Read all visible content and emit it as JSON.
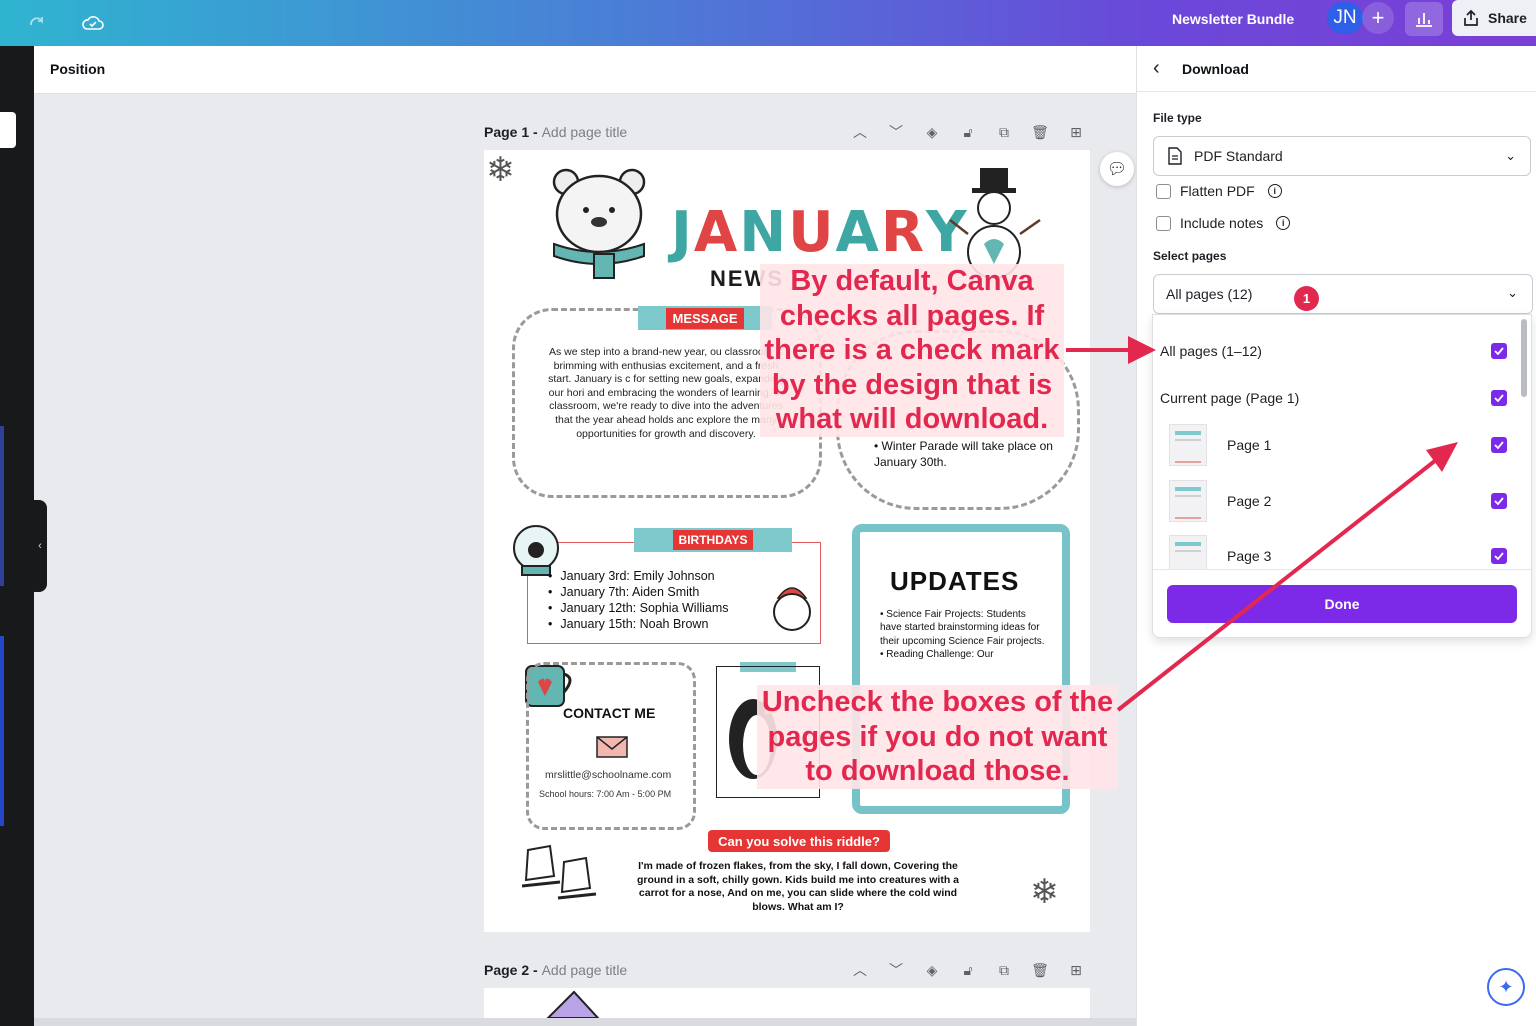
{
  "topbar": {
    "title": "Newsletter Bundle",
    "avatar_initials": "JN",
    "add_symbol": "+",
    "share_label": "Share"
  },
  "toolbar": {
    "position_label": "Position"
  },
  "pages": [
    {
      "label": "Page 1 - ",
      "title_placeholder": "Add page title"
    },
    {
      "label": "Page 2 - ",
      "title_placeholder": "Add page title"
    }
  ],
  "newsletter": {
    "title_letters": [
      "J",
      "A",
      "N",
      "U",
      "A",
      "R",
      "Y"
    ],
    "subtitle": "NEWS",
    "message_banner": "MESSAGE",
    "message_text": "As we step into a brand-new year, ou classroom is brimming with enthusias excitement, and a fresh start. January is c for setting new goals, expanding our hori and embracing the wonders of learning. In classroom, we're ready to dive into the adventures that the year ahead holds anc explore the many opportunities for growth and discovery.",
    "winter_parade": "Winter Parade will take place on January 30th.",
    "birthdays_banner": "BIRTHDAYS",
    "birthdays": [
      "January 3rd: Emily Johnson",
      "January 7th: Aiden Smith",
      "January 12th: Sophia Williams",
      "January 15th: Noah Brown"
    ],
    "updates_title": "UPDATES",
    "updates_items": [
      "Science Fair Projects: Students have started brainstorming ideas for their upcoming Science Fair projects.",
      "Reading Challenge: Our"
    ],
    "contact_title": "CONTACT ME",
    "contact_email": "mrslittle@schoolname.com",
    "contact_hours": "School hours: 7:00 Am - 5:00 PM",
    "riddle_banner": "Can you solve this riddle?",
    "riddle_text": "I'm made of frozen flakes, from the sky, I fall down, Covering the ground in a soft, chilly gown. Kids build me into creatures with a carrot for a nose, And on me, you can slide where the cold wind blows. What am I?"
  },
  "annotations": {
    "note1": "By default, Canva checks all pages. If there is a check mark by the design that is what will download.",
    "note2": "Uncheck the boxes of the pages if you do not want to download those.",
    "colors": {
      "accent": "#e3284f",
      "highlight": "#ffe4e8"
    }
  },
  "download_panel": {
    "title": "Download",
    "file_type_label": "File type",
    "file_type_value": "PDF Standard",
    "flatten_pdf": {
      "label": "Flatten PDF",
      "checked": false
    },
    "include_notes": {
      "label": "Include notes",
      "checked": false
    },
    "select_pages_label": "Select pages",
    "select_pages_value": "All pages (12)",
    "step_badge": "1",
    "options": [
      {
        "label": "All pages (1–12)",
        "checked": true,
        "thumb": false
      },
      {
        "label": "Current page (Page 1)",
        "checked": true,
        "thumb": false
      },
      {
        "label": "Page 1",
        "checked": true,
        "thumb": true
      },
      {
        "label": "Page 2",
        "checked": true,
        "thumb": true
      },
      {
        "label": "Page 3",
        "checked": true,
        "thumb": true
      }
    ],
    "done_label": "Done",
    "accent_color": "#7d2ae8"
  }
}
